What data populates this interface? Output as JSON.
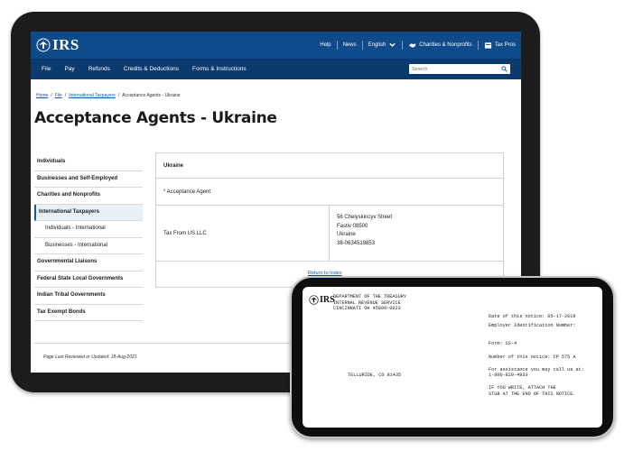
{
  "header": {
    "logo_text": "IRS",
    "utility": [
      "Help",
      "News",
      "English",
      "Charities & Nonprofits",
      "Tax Pros"
    ]
  },
  "nav": {
    "items": [
      "File",
      "Pay",
      "Refunds",
      "Credits & Deductions",
      "Forms & Instructions"
    ],
    "search_placeholder": "Search"
  },
  "breadcrumb": {
    "home": "Home",
    "file": "File",
    "intl": "International Taxpayers",
    "current": "Acceptance Agents - Ukraine",
    "sep": "/"
  },
  "page_title": "Acceptance Agents - Ukraine",
  "sidebar": {
    "items": [
      "Individuals",
      "Businesses and Self-Employed",
      "Charities and Nonprofits",
      "International Taxpayers",
      "Individuals - International",
      "Businesses - International",
      "Governmental Liaisons",
      "Federal State Local Governments",
      "Indian Tribal Governments",
      "Tax Exempt Bonds"
    ]
  },
  "table": {
    "country": "Ukraine",
    "agent_type": "* Acceptance Agent",
    "agent_name": "Tax From US LLC",
    "address": [
      "56 Chelyskincyv Street",
      "Fastiv 08500",
      "Ukraine",
      "38-0634519853"
    ],
    "return_link": "Return to Index"
  },
  "last_reviewed": "Page Last Reviewed or Updated: 18-Aug-2021",
  "notice": {
    "logo_text": "IRS",
    "dept": [
      "DEPARTMENT OF THE TREASURY",
      "INTERNAL REVENUE SERVICE",
      "CINCINNATI  OH   45999-0023"
    ],
    "date": "Date of this notice:  05-17-2019",
    "ein": "Employer Identification Number:",
    "form": "Form:  SS-4",
    "number": "Number of this notice:  CP 575 A",
    "assist1": "For assistance you may call us at:",
    "assist2": "1-800-829-4933",
    "write1": "IF YOU WRITE, ATTACH THE",
    "write2": "STUB AT THE END OF THIS NOTICE.",
    "address": "TELLURIDE, CO  81435"
  },
  "colors": {
    "irs_blue": "#0f4a8a",
    "irs_nav": "#0b3a6e",
    "link": "#1a55a0"
  }
}
